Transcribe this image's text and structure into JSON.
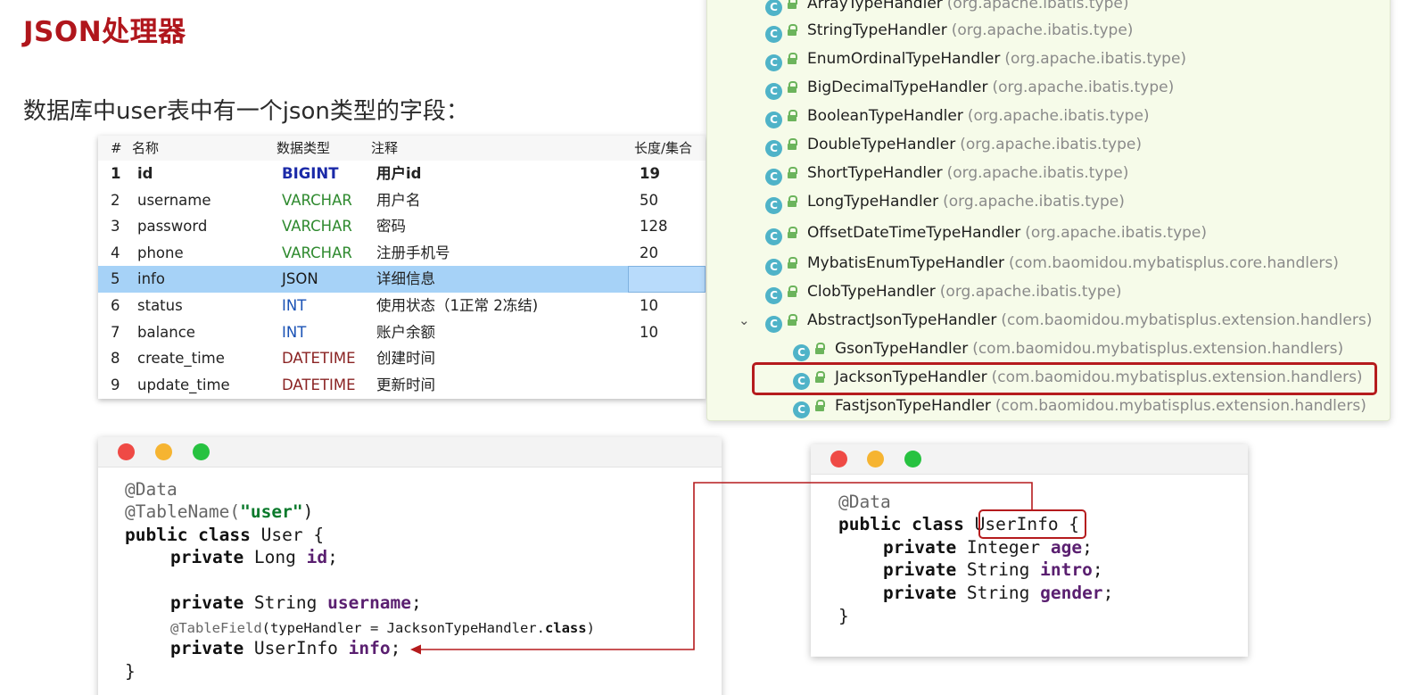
{
  "slide": {
    "title": "JSON处理器",
    "subtitle": "数据库中user表中有一个json类型的字段："
  },
  "db_table": {
    "columns": [
      "#",
      "名称",
      "数据类型",
      "注释",
      "长度/集合"
    ],
    "rows": [
      {
        "num": "1",
        "name": "id",
        "type": "BIGINT",
        "comment": "用户id",
        "length": "19"
      },
      {
        "num": "2",
        "name": "username",
        "type": "VARCHAR",
        "comment": "用户名",
        "length": "50"
      },
      {
        "num": "3",
        "name": "password",
        "type": "VARCHAR",
        "comment": "密码",
        "length": "128"
      },
      {
        "num": "4",
        "name": "phone",
        "type": "VARCHAR",
        "comment": "注册手机号",
        "length": "20"
      },
      {
        "num": "5",
        "name": "info",
        "type": "JSON",
        "comment": "详细信息",
        "length": ""
      },
      {
        "num": "6",
        "name": "status",
        "type": "INT",
        "comment": "使用状态（1正常 2冻结)",
        "length": "10"
      },
      {
        "num": "7",
        "name": "balance",
        "type": "INT",
        "comment": "账户余额",
        "length": "10"
      },
      {
        "num": "8",
        "name": "create_time",
        "type": "DATETIME",
        "comment": "创建时间",
        "length": ""
      },
      {
        "num": "9",
        "name": "update_time",
        "type": "DATETIME",
        "comment": "更新时间",
        "length": ""
      }
    ],
    "selected_row": "5"
  },
  "class_tree": {
    "icon_letter": "C",
    "items": [
      {
        "name": "ArrayTypeHandler",
        "package": "(org.apache.ibatis.type)"
      },
      {
        "name": "StringTypeHandler",
        "package": "(org.apache.ibatis.type)"
      },
      {
        "name": "EnumOrdinalTypeHandler",
        "package": "(org.apache.ibatis.type)"
      },
      {
        "name": "BigDecimalTypeHandler",
        "package": "(org.apache.ibatis.type)"
      },
      {
        "name": "BooleanTypeHandler",
        "package": "(org.apache.ibatis.type)"
      },
      {
        "name": "DoubleTypeHandler",
        "package": "(org.apache.ibatis.type)"
      },
      {
        "name": "ShortTypeHandler",
        "package": "(org.apache.ibatis.type)"
      },
      {
        "name": "LongTypeHandler",
        "package": "(org.apache.ibatis.type)"
      },
      {
        "name": "OffsetDateTimeTypeHandler",
        "package": "(org.apache.ibatis.type)"
      },
      {
        "name": "MybatisEnumTypeHandler",
        "package": "(com.baomidou.mybatisplus.core.handlers)"
      },
      {
        "name": "ClobTypeHandler",
        "package": "(org.apache.ibatis.type)"
      },
      {
        "name": "AbstractJsonTypeHandler",
        "package": "(com.baomidou.mybatisplus.extension.handlers)"
      },
      {
        "name": "GsonTypeHandler",
        "package": "(com.baomidou.mybatisplus.extension.handlers)"
      },
      {
        "name": "JacksonTypeHandler",
        "package": "(com.baomidou.mybatisplus.extension.handlers)"
      },
      {
        "name": "FastjsonTypeHandler",
        "package": "(com.baomidou.mybatisplus.extension.handlers)"
      }
    ]
  },
  "code_user": {
    "lines": {
      "l1": "@Data",
      "l2_ann": "@TableName(",
      "l2_str": "\"user\"",
      "l2_end": ")",
      "l3_kw": "public class",
      "l3_rest": " User {",
      "l4_kw": "private",
      "l4_type": " Long ",
      "l4_fld": "id",
      "l4_end": ";",
      "l5_kw": "private",
      "l5_type": " String ",
      "l5_fld": "username",
      "l5_end": ";",
      "l6_ann": "@TableField",
      "l6_mid": "(typeHandler = JacksonTypeHandler.",
      "l6_kw": "class",
      "l6_end": ")",
      "l7_kw": "private",
      "l7_type": " UserInfo ",
      "l7_fld": "info",
      "l7_end": ";",
      "l8": "}"
    }
  },
  "code_userinfo": {
    "lines": {
      "l1": "@Data",
      "l2_kw": "public class",
      "l2_name": "UserInfo",
      "l2_end": " {",
      "l3_kw": "private",
      "l3_type": " Integer ",
      "l3_fld": "age",
      "l3_end": ";",
      "l4_kw": "private",
      "l4_type": " String ",
      "l4_fld": "intro",
      "l4_end": ";",
      "l5_kw": "private",
      "l5_type": " String ",
      "l5_fld": "gender",
      "l5_end": ";",
      "l6": "}"
    }
  },
  "colors": {
    "title": "#b0161c",
    "highlight": "#b51b1d",
    "selection": "#a6d2f7",
    "tree_bg": "#f6fbe9"
  }
}
